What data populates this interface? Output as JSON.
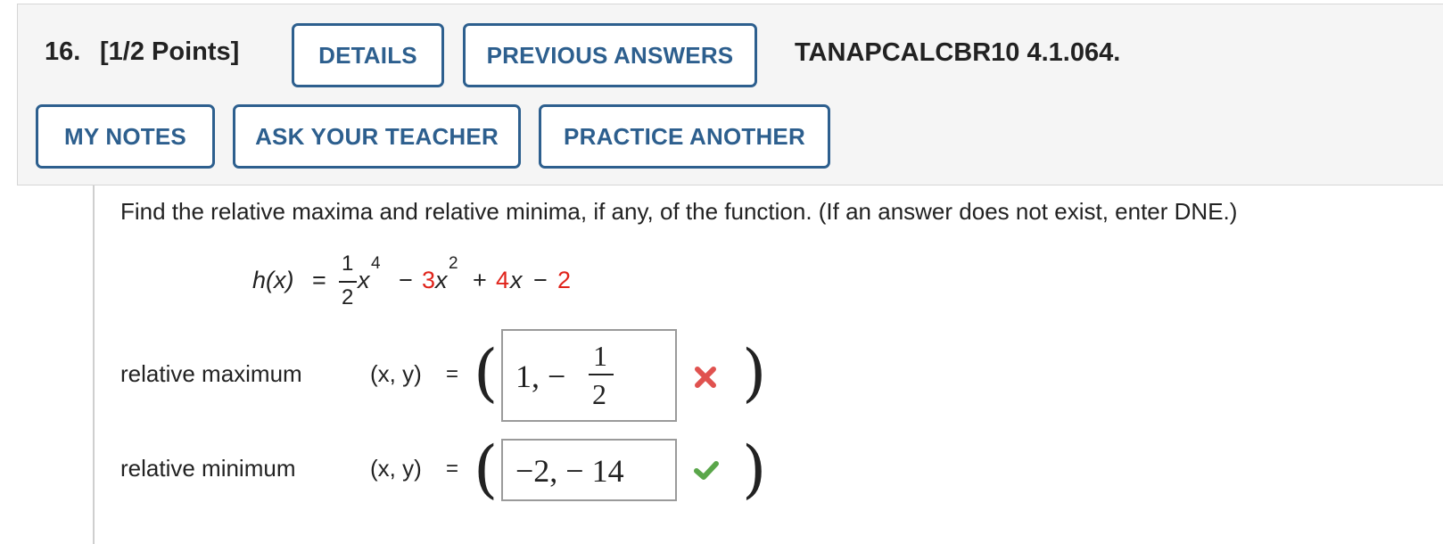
{
  "question": {
    "number": "16.",
    "points": "[1/2 Points]",
    "id": "TANAPCALCBR10 4.1.064."
  },
  "buttons": {
    "details": "DETAILS",
    "previous_answers": "PREVIOUS ANSWERS",
    "my_notes": "MY NOTES",
    "ask_teacher": "ASK YOUR TEACHER",
    "practice_another": "PRACTICE ANOTHER"
  },
  "prompt": "Find the relative maxima and relative minima, if any, of the function. (If an answer does not exist, enter DNE.)",
  "function": {
    "lhs": "h(x)",
    "equals": "=",
    "frac_num": "1",
    "frac_den": "2",
    "x": "x",
    "exp4": "4",
    "minus1": "−",
    "coef3": "3",
    "x2": "x",
    "exp2": "2",
    "plus": "+",
    "coef4": "4",
    "x3": "x",
    "minus2": "−",
    "const": "2"
  },
  "rows": {
    "max": {
      "label": "relative maximum",
      "pair": "(x, y)",
      "equals": "=",
      "answer_lead": "1, −",
      "answer_num": "1",
      "answer_den": "2",
      "status": "incorrect",
      "status_icon": "cross-icon"
    },
    "min": {
      "label": "relative minimum",
      "pair": "(x, y)",
      "equals": "=",
      "answer": "−2, − 14",
      "status": "correct",
      "status_icon": "check-icon"
    }
  },
  "colors": {
    "button_border": "#2d5f8e",
    "coefficient_red": "#e0241b",
    "incorrect": "#e0524f",
    "correct": "#5aa64a"
  }
}
